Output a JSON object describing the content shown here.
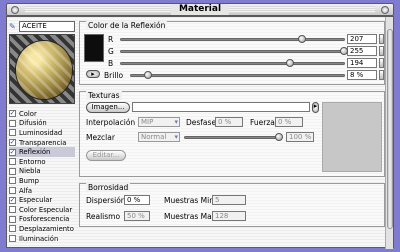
{
  "window": {
    "title": "Material"
  },
  "material": {
    "name": "ACEITE"
  },
  "channels": [
    {
      "label": "Color",
      "checked": true
    },
    {
      "label": "Difusión",
      "checked": false
    },
    {
      "label": "Luminosidad",
      "checked": false
    },
    {
      "label": "Transparencia",
      "checked": true
    },
    {
      "label": "Reflexión",
      "checked": true,
      "active": true
    },
    {
      "label": "Entorno",
      "checked": false
    },
    {
      "label": "Niebla",
      "checked": false
    },
    {
      "label": "Bump",
      "checked": false
    },
    {
      "label": "Alfa",
      "checked": false
    },
    {
      "label": "Especular",
      "checked": true
    },
    {
      "label": "Color Especular",
      "checked": false
    },
    {
      "label": "Fosforescencia",
      "checked": false
    },
    {
      "label": "Desplazamiento",
      "checked": false
    },
    {
      "label": "Iluminación",
      "checked": false
    }
  ],
  "reflection_color": {
    "title": "Color de la Reflexión",
    "r": {
      "label": "R",
      "value": "207"
    },
    "g": {
      "label": "G",
      "value": "255"
    },
    "b": {
      "label": "B",
      "value": "194"
    },
    "brightness": {
      "label": "Brillo",
      "value": "8 %"
    }
  },
  "textures": {
    "title": "Texturas",
    "image_button": "Imagen...",
    "image_path": "",
    "interpolation_label": "Interpolación",
    "interpolation_value": "MIP",
    "blur_offset_label": "Desfase",
    "blur_offset_value": "0 %",
    "blur_strength_label": "Fuerza",
    "blur_strength_value": "0 %",
    "mix_label": "Mezclar",
    "mix_mode_value": "Normal",
    "mix_strength_value": "100 %",
    "edit_button": "Editar..."
  },
  "blurriness": {
    "title": "Borrosidad",
    "dispersion_label": "Dispersión",
    "dispersion_value": "0 %",
    "min_samples_label": "Muestras Min",
    "min_samples_value": "5",
    "realism_label": "Realismo",
    "realism_value": "50 %",
    "max_samples_label": "Muestras Max",
    "max_samples_value": "128"
  },
  "colors": {
    "swatch": "#0d0d0d",
    "background_frame": "#7f7ccf",
    "accent": "#2c4fa8"
  },
  "slider_positions": {
    "r": 0.81,
    "g": 1.0,
    "b": 0.76,
    "brightness": 0.08,
    "mix_strength": 1.0
  }
}
